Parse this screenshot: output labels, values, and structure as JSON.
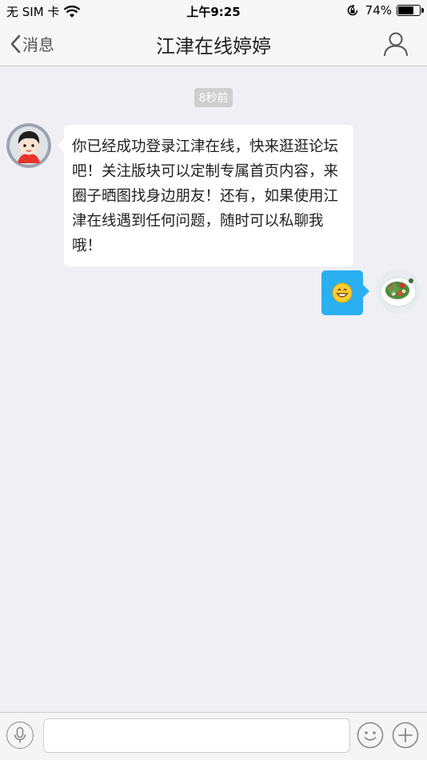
{
  "status_bar": {
    "carrier": "无 SIM 卡",
    "time": "上午9:25",
    "battery": "74%",
    "battery_level": 0.74
  },
  "nav": {
    "back_label": "消息",
    "title": "江津在线婷婷"
  },
  "chat": {
    "timestamp": "8秒前",
    "messages": [
      {
        "direction": "incoming",
        "text": "你已经成功登录江津在线，快来逛逛论坛吧！关注版块可以定制专属首页内容，来圈子晒图找身边朋友！还有，如果使用江津在线遇到任何问题，随时可以私聊我哦！"
      },
      {
        "direction": "outgoing",
        "content": "grinning-emoji"
      }
    ]
  },
  "input_bar": {
    "placeholder": ""
  },
  "colors": {
    "accent": "#2ab0f0",
    "background": "#efeff4"
  }
}
